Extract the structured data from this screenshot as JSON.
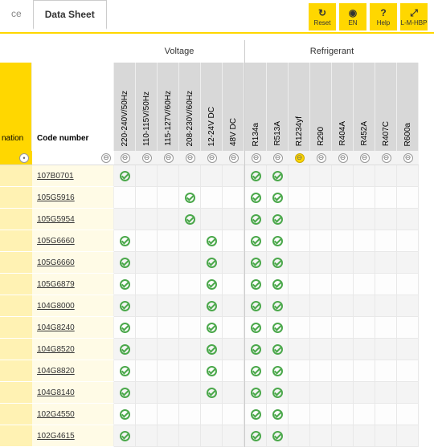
{
  "tabs": {
    "partial": "ce",
    "active": "Data Sheet"
  },
  "toolbar": [
    {
      "name": "reset-button",
      "label": "Reset",
      "icon": "↻"
    },
    {
      "name": "lang-button",
      "label": "EN",
      "icon": "◉"
    },
    {
      "name": "help-button",
      "label": "Help",
      "icon": "?"
    },
    {
      "name": "units-button",
      "label": "L-M-HBP",
      "icon": "⤢"
    }
  ],
  "groups": {
    "voltage": "Voltage",
    "refrigerant": "Refrigerant"
  },
  "left_headers": {
    "nation": "nation",
    "code": "Code number"
  },
  "voltage_cols": [
    "220-240V/50Hz",
    "110-115V/50Hz",
    "115-127V/60Hz",
    "208-230V/60Hz",
    "12-24V DC",
    "48V DC"
  ],
  "refrigerant_cols": [
    "R134a",
    "R513A",
    "R1234yf",
    "R290",
    "R404A",
    "R452A",
    "R407C",
    "R600a"
  ],
  "active_filter_col": "R1234yf",
  "rows": [
    {
      "code": "107B0701",
      "voltage": [
        1,
        0,
        0,
        0,
        0,
        0
      ],
      "refr": [
        1,
        1,
        0,
        0,
        0,
        0,
        0,
        0
      ]
    },
    {
      "code": "105G5916",
      "voltage": [
        0,
        0,
        0,
        1,
        0,
        0
      ],
      "refr": [
        1,
        1,
        0,
        0,
        0,
        0,
        0,
        0
      ]
    },
    {
      "code": "105G5954",
      "voltage": [
        0,
        0,
        0,
        1,
        0,
        0
      ],
      "refr": [
        1,
        1,
        0,
        0,
        0,
        0,
        0,
        0
      ]
    },
    {
      "code": "105G6660",
      "voltage": [
        1,
        0,
        0,
        0,
        1,
        0
      ],
      "refr": [
        1,
        1,
        0,
        0,
        0,
        0,
        0,
        0
      ]
    },
    {
      "code": "105G6660",
      "voltage": [
        1,
        0,
        0,
        0,
        1,
        0
      ],
      "refr": [
        1,
        1,
        0,
        0,
        0,
        0,
        0,
        0
      ]
    },
    {
      "code": "105G6879",
      "voltage": [
        1,
        0,
        0,
        0,
        1,
        0
      ],
      "refr": [
        1,
        1,
        0,
        0,
        0,
        0,
        0,
        0
      ]
    },
    {
      "code": "104G8000",
      "voltage": [
        1,
        0,
        0,
        0,
        1,
        0
      ],
      "refr": [
        1,
        1,
        0,
        0,
        0,
        0,
        0,
        0
      ]
    },
    {
      "code": "104G8240",
      "voltage": [
        1,
        0,
        0,
        0,
        1,
        0
      ],
      "refr": [
        1,
        1,
        0,
        0,
        0,
        0,
        0,
        0
      ]
    },
    {
      "code": "104G8520",
      "voltage": [
        1,
        0,
        0,
        0,
        1,
        0
      ],
      "refr": [
        1,
        1,
        0,
        0,
        0,
        0,
        0,
        0
      ]
    },
    {
      "code": "104G8820",
      "voltage": [
        1,
        0,
        0,
        0,
        1,
        0
      ],
      "refr": [
        1,
        1,
        0,
        0,
        0,
        0,
        0,
        0
      ]
    },
    {
      "code": "104G8140",
      "voltage": [
        1,
        0,
        0,
        0,
        1,
        0
      ],
      "refr": [
        1,
        1,
        0,
        0,
        0,
        0,
        0,
        0
      ]
    },
    {
      "code": "102G4550",
      "voltage": [
        1,
        0,
        0,
        0,
        0,
        0
      ],
      "refr": [
        1,
        1,
        0,
        0,
        0,
        0,
        0,
        0
      ]
    },
    {
      "code": "102G4615",
      "voltage": [
        1,
        0,
        0,
        0,
        0,
        0
      ],
      "refr": [
        1,
        1,
        0,
        0,
        0,
        0,
        0,
        0
      ]
    }
  ]
}
